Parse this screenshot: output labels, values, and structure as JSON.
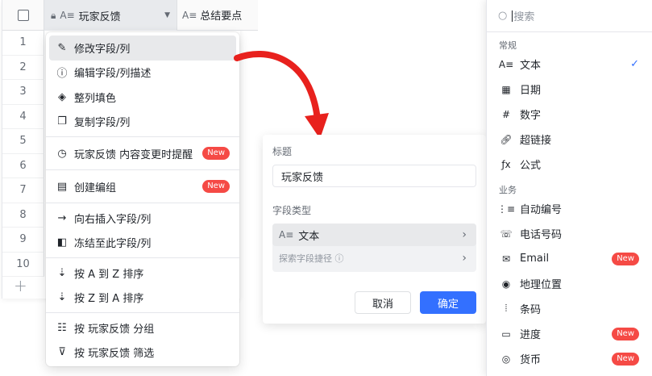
{
  "table": {
    "col1_header": "玩家反馈",
    "col2_header": "总结要点",
    "row_numbers": [
      "1",
      "2",
      "3",
      "4",
      "5",
      "6",
      "7",
      "8",
      "9",
      "10"
    ],
    "add_symbol": "+"
  },
  "menu": {
    "items": [
      {
        "label": "修改字段/列",
        "icon": "pencil-icon",
        "glyph": "✎"
      },
      {
        "label": "编辑字段/列描述",
        "icon": "info-icon",
        "glyph": "ⓘ"
      },
      {
        "label": "整列填色",
        "icon": "paint-bucket-icon",
        "glyph": "◈"
      },
      {
        "label": "复制字段/列",
        "icon": "copy-icon",
        "glyph": "❐"
      },
      {
        "label": "玩家反馈 内容变更时提醒",
        "icon": "clock-alert-icon",
        "glyph": "◷",
        "badge": "New"
      },
      {
        "label": "创建编组",
        "icon": "group-icon",
        "glyph": "▤",
        "badge": "New"
      },
      {
        "label": "向右插入字段/列",
        "icon": "arrow-right-icon",
        "glyph": "→"
      },
      {
        "label": "冻结至此字段/列",
        "icon": "freeze-icon",
        "glyph": "◧"
      },
      {
        "label": "按 A 到 Z 排序",
        "icon": "sort-asc-icon",
        "glyph": "⇣"
      },
      {
        "label": "按 Z 到 A 排序",
        "icon": "sort-desc-icon",
        "glyph": "⇣"
      },
      {
        "label": "按 玩家反馈 分组",
        "icon": "group-by-icon",
        "glyph": "☷"
      },
      {
        "label": "按 玩家反馈 筛选",
        "icon": "filter-icon",
        "glyph": "⊽"
      }
    ]
  },
  "form": {
    "title_label": "标题",
    "title_value": "玩家反馈",
    "type_label": "字段类型",
    "type_value": "文本",
    "explore_label": "探索字段捷径 ⓘ",
    "cancel_label": "取消",
    "ok_label": "确定"
  },
  "types": {
    "search_placeholder": "搜索",
    "groups": [
      {
        "label": "常规",
        "items": [
          {
            "label": "文本",
            "glyph": "A≡",
            "icon": "text-icon",
            "checked": true
          },
          {
            "label": "日期",
            "glyph": "▦",
            "icon": "calendar-icon"
          },
          {
            "label": "数字",
            "glyph": "#",
            "icon": "number-icon"
          },
          {
            "label": "超链接",
            "glyph": "🔗︎",
            "icon": "link-icon"
          },
          {
            "label": "公式",
            "glyph": "ƒx",
            "icon": "formula-icon"
          }
        ]
      },
      {
        "label": "业务",
        "items": [
          {
            "label": "自动编号",
            "glyph": "⋮≡",
            "icon": "auto-number-icon"
          },
          {
            "label": "电话号码",
            "glyph": "☏",
            "icon": "phone-icon"
          },
          {
            "label": "Email",
            "glyph": "✉",
            "icon": "email-icon",
            "badge": "New"
          },
          {
            "label": "地理位置",
            "glyph": "◉",
            "icon": "location-icon"
          },
          {
            "label": "条码",
            "glyph": "⦙",
            "icon": "barcode-icon"
          },
          {
            "label": "进度",
            "glyph": "▭",
            "icon": "progress-icon",
            "badge": "New"
          },
          {
            "label": "货币",
            "glyph": "◎",
            "icon": "currency-icon",
            "badge": "New"
          }
        ]
      }
    ]
  },
  "colors": {
    "accent": "#3370ff",
    "badge": "#f54a45",
    "arrow": "#e8211d"
  }
}
